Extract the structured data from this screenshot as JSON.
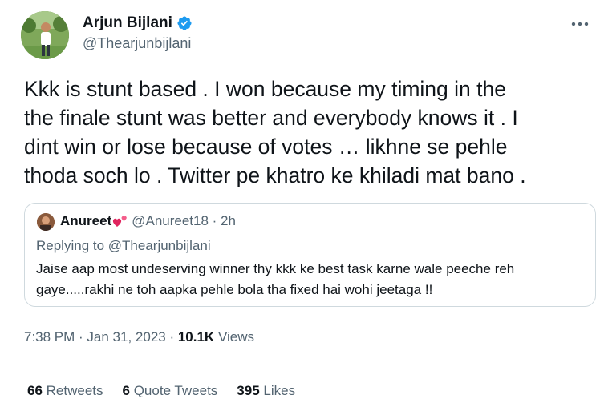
{
  "author": {
    "name": "Arjun Bijlani",
    "handle": "@Thearjunbijlani",
    "verified_color": "#1d9bf0"
  },
  "icons": {
    "verified": "verified-badge-icon",
    "more": "more-options-icon",
    "heart": "two-hearts-emoji-icon"
  },
  "tweet": {
    "lines": [
      "Kkk is stunt based . I won because my timing in the",
      "the finale stunt was better and everybody knows it . I",
      "dint win or lose because of votes … likhne se pehle",
      "thoda soch lo . Twitter pe khatro ke khiladi mat bano ."
    ]
  },
  "quote": {
    "name": "Anureet",
    "handle_time": "@Anureet18 · 2h",
    "replying_prefix": "Replying to ",
    "replying_handle": "@Thearjunbijlani",
    "lines": [
      "Jaise aap most undeserving winner thy kkk ke best task karne wale peeche reh",
      "gaye.....rakhi ne toh aapka pehle bola tha fixed hai wohi jeetaga !!"
    ]
  },
  "meta": {
    "timestamp": "7:38 PM · Jan 31, 2023 · ",
    "views_count": "10.1K",
    "views_label": " Views"
  },
  "stats": {
    "retweets_count": "66",
    "retweets_label": " Retweets",
    "quotes_count": "6",
    "quotes_label": " Quote Tweets",
    "likes_count": "395",
    "likes_label": " Likes"
  }
}
